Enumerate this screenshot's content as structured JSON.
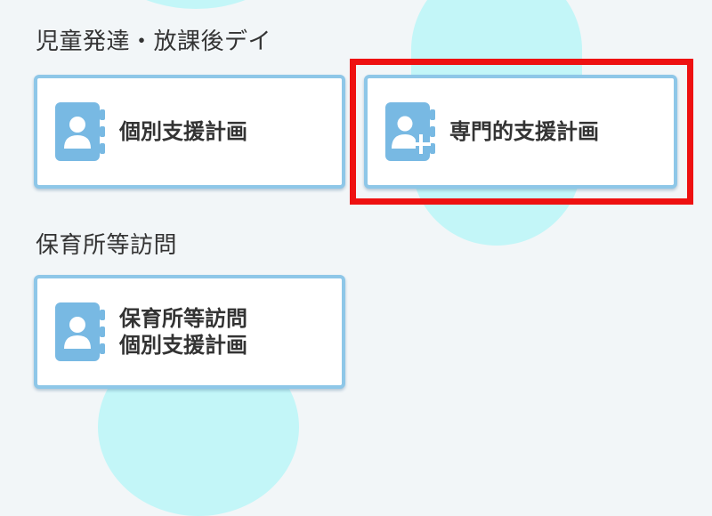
{
  "sections": [
    {
      "title": "児童発達・放課後デイ",
      "cards": [
        {
          "label": "個別支援計画",
          "icon": "contact-book-icon"
        },
        {
          "label": "専門的支援計画",
          "icon": "contact-book-plus-icon"
        }
      ]
    },
    {
      "title": "保育所等訪問",
      "cards": [
        {
          "label_lines": [
            "保育所等訪問",
            "個別支援計画"
          ],
          "icon": "contact-book-icon"
        }
      ]
    }
  ],
  "colors": {
    "card_border": "#8ec7e8",
    "icon_fill": "#78b9e3",
    "background": "#f2f6f8",
    "bg_circle": "#c3f6f8",
    "highlight": "#ee1111"
  }
}
